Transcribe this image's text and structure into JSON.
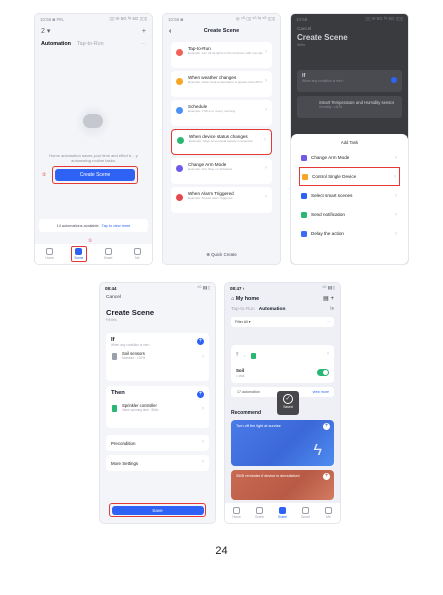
{
  "phone1": {
    "status_time": "10:55 ◙ ##L",
    "status_right": "▯▯ ✉ 5G ²ᵍ 5G ▯▯▯",
    "top_left": "2 ▾",
    "top_plus": "+",
    "tab_automation": "Automation",
    "tab_tap_to_run": "Tap-to-Run",
    "tab_more": "···",
    "empty_text": "Home automation saves your time and effort b...\ny automating routine tasks.",
    "marker_2": "②",
    "create_scene": "Create Scene",
    "available_text": "14 automations available.",
    "available_link": "Tap to view more",
    "marker_1": "①",
    "nav": [
      {
        "label": "Home"
      },
      {
        "label": "Scene"
      },
      {
        "label": "Smart"
      },
      {
        "label": "Me"
      }
    ]
  },
  "phone2": {
    "status_time": "10:56 ◙",
    "status_right": "◎ ⁴ᴳ ▯▯ ⁵ᴳ ²ᵍ ⁵ᴳ ▯▯▯",
    "back": "‹",
    "title": "Create Scene",
    "options": [
      {
        "name": "Tap-to-Run",
        "desc": "Example: turn off all lights in the bedroom with one tap.",
        "color": "#f0625a"
      },
      {
        "name": "When weather changes",
        "desc": "Example: when local temperature is greater than 28°C.",
        "color": "#f5a623"
      },
      {
        "name": "Schedule",
        "desc": "Example: 7:00 a.m. every morning",
        "color": "#4a90f5"
      },
      {
        "name": "When device status changes",
        "desc": "Example: when an unusual activity is detected.",
        "color": "#2ab673"
      },
      {
        "name": "Change Arm Mode",
        "desc": "Example: Arm Stay on Schedule",
        "color": "#6c5ce7"
      },
      {
        "name": "When Alarm Triggered",
        "desc": "Example: Smoke Alert Triggered",
        "color": "#e5484d"
      }
    ],
    "quick_create": "⊕ Quick Create"
  },
  "phone3": {
    "status_time": "10:58",
    "status_right": "▯▯ ✉ 5G ²ᵍ 5G ▯▯▯",
    "cancel": "Cancel",
    "title": "Create Scene",
    "sub": "Write",
    "if_title": "If",
    "if_sub": "When any condition is met ›",
    "device_name": "Smart Temperature and Humidity sensor",
    "device_sub": "Humidity : ≥60%",
    "sheet_title": "Add Task",
    "sheet_rows": [
      {
        "label": "Change Arm Mode",
        "color": "#6c5ce7"
      },
      {
        "label": "Control Single Device",
        "color": "#f5a623"
      },
      {
        "label": "Select smart scenes",
        "color": "#2d62f5"
      },
      {
        "label": "Send notification",
        "color": "#2ab673"
      },
      {
        "label": "Delay the action",
        "color": "#3b6cf6"
      }
    ]
  },
  "phone4": {
    "status_time": "08:44",
    "status_right": "⁵ᴳ ▮▮▯",
    "cancel": "Cancel",
    "title": "Create Scene",
    "sub": "Fill this",
    "if_head": "If",
    "if_sub": "When any condition is met ›",
    "if_device_name": "Soil sensors",
    "if_device_desc": "Moisture : <20%",
    "then_head": "Then",
    "then_device_name": "Sprinkler controller",
    "then_device_desc": "Valve opening time : 5Min",
    "precondition": "Precondition",
    "more_settings": "More Settings",
    "save": "Save"
  },
  "phone5": {
    "status_time": "08:47 ›",
    "status_right": "⁵ᴳ ▮▮▯",
    "home_title": "⌂ My home",
    "home_icons": "▤  +",
    "tab_tap_to_run": "Tap-to-Run",
    "tab_automation": "Automation",
    "tabs_right": "⁞≡",
    "filter": "Filter All ▾",
    "filter_right": "⋯",
    "scene_name": "Soil",
    "scene_tasks": "1 task",
    "avail_text": "17 automation",
    "avail_link": "view more",
    "saved": "Saved",
    "recommend": "Recommend",
    "reco_a": "Turn off the light at sunrise",
    "reco_b": "SMS reminder if device is demolished",
    "nav": [
      {
        "label": "Home"
      },
      {
        "label": "Scene"
      },
      {
        "label": "Scene"
      },
      {
        "label": "Smart"
      },
      {
        "label": "Me"
      }
    ]
  },
  "page_number": "24"
}
